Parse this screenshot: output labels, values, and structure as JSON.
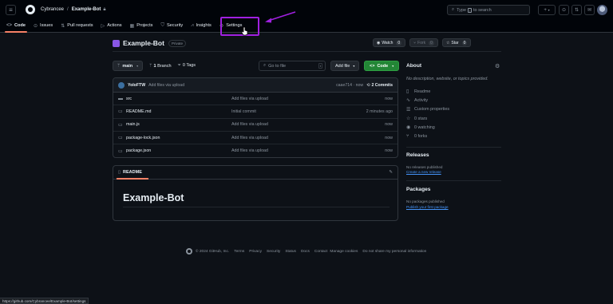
{
  "header": {
    "owner": "Cybrancee",
    "separator": "/",
    "repo": "Example-Bot",
    "search_placeholder_before": "Type",
    "search_key": "/",
    "search_placeholder_after": "to search",
    "buttons": [
      "+",
      "⊙",
      "⇅",
      "✉"
    ]
  },
  "tabs": [
    {
      "label": "Code",
      "icon": "code-icon"
    },
    {
      "label": "Issues",
      "icon": "issue-icon"
    },
    {
      "label": "Pull requests",
      "icon": "pull-request-icon"
    },
    {
      "label": "Actions",
      "icon": "actions-icon"
    },
    {
      "label": "Projects",
      "icon": "projects-icon"
    },
    {
      "label": "Security",
      "icon": "shield-icon"
    },
    {
      "label": "Insights",
      "icon": "graph-icon"
    },
    {
      "label": "Settings",
      "icon": "gear-icon"
    }
  ],
  "repo": {
    "name": "Example-Bot",
    "visibility": "Private",
    "watch": {
      "label": "Watch",
      "count": "0"
    },
    "fork": {
      "label": "Fork",
      "count": "0"
    },
    "star": {
      "label": "Star",
      "count": "0"
    }
  },
  "branch_bar": {
    "branch": "main",
    "branches": "1",
    "branches_label": "Branch",
    "tags": "0",
    "tags_label": "Tags",
    "goto_placeholder": "Go to file",
    "goto_key": "t",
    "add_file": "Add file",
    "code": "Code"
  },
  "commit": {
    "user": "YoloFTW",
    "message": "Add files via upload",
    "hash_time": "caae714 · now",
    "count_label": "2 Commits"
  },
  "files": [
    {
      "type": "folder",
      "name": "src",
      "message": "Add files via upload",
      "time": "now"
    },
    {
      "type": "file",
      "name": "README.md",
      "message": "Initial commit",
      "time": "2 minutes ago"
    },
    {
      "type": "file",
      "name": "main.js",
      "message": "Add files via upload",
      "time": "now"
    },
    {
      "type": "file",
      "name": "package-lock.json",
      "message": "Add files via upload",
      "time": "now"
    },
    {
      "type": "file",
      "name": "package.json",
      "message": "Add files via upload",
      "time": "now"
    }
  ],
  "readme": {
    "tab_label": "README",
    "heading": "Example-Bot"
  },
  "sidebar": {
    "about_title": "About",
    "description": "No description, website, or topics provided.",
    "items": [
      {
        "icon": "book-icon",
        "label": "Readme"
      },
      {
        "icon": "pulse-icon",
        "label": "Activity"
      },
      {
        "icon": "sliders-icon",
        "label": "Custom properties"
      },
      {
        "icon": "star-icon",
        "label": "0 stars"
      },
      {
        "icon": "eye-icon",
        "label": "0 watching"
      },
      {
        "icon": "fork-icon",
        "label": "0 forks"
      }
    ],
    "releases_title": "Releases",
    "releases_text": "No releases published",
    "releases_link": "Create a new release",
    "packages_title": "Packages",
    "packages_text": "No packages published",
    "packages_link": "Publish your first package"
  },
  "footer": {
    "copyright": "© 2024 GitHub, Inc.",
    "links": [
      "Terms",
      "Privacy",
      "Security",
      "Status",
      "Docs",
      "Contact",
      "Manage cookies",
      "Do not share my personal information"
    ]
  },
  "status_url": "https://github.com/Cybrancee/Example-Bot/settings",
  "colors": {
    "accent_highlight": "#a020e0",
    "primary_button": "#238636",
    "tab_underline": "#f78166",
    "link": "#4493f8"
  }
}
